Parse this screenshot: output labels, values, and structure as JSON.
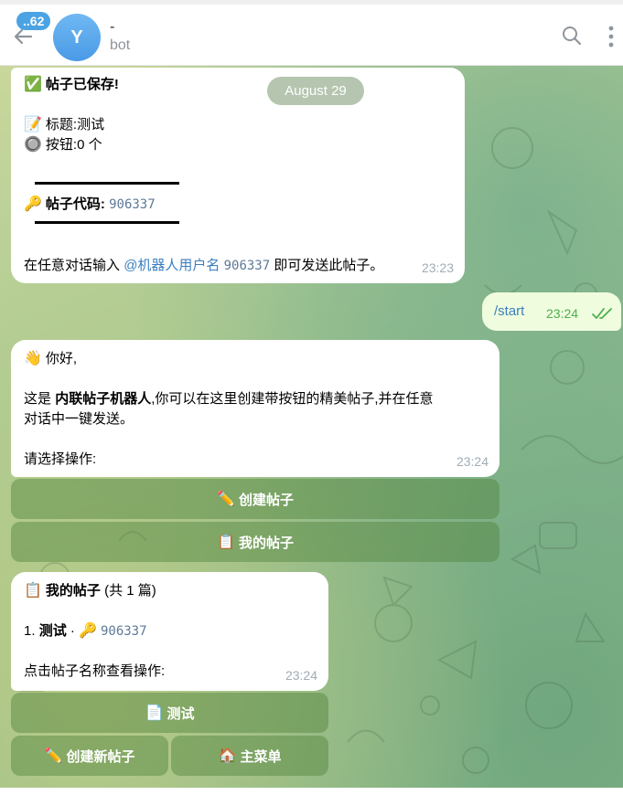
{
  "header": {
    "unread_count": "..62",
    "avatar_letter": "Y",
    "chat_name": "-",
    "chat_status": "bot"
  },
  "date_pill": "August 29",
  "msg_saved": {
    "title": "帖子已保存!",
    "title_label": "标题:",
    "title_value": "测试",
    "buttons_label": "按钮:",
    "buttons_value": "0 个",
    "code_label": "帖子代码:",
    "code_value": "906337",
    "hint_pre": "在任意对话输入",
    "hint_mention": "@机器人用户名",
    "hint_code": "906337",
    "hint_post": "即可发送此帖子。",
    "time": "23:23"
  },
  "msg_start": {
    "text": "/start",
    "time": "23:24"
  },
  "msg_welcome": {
    "greeting": "你好,",
    "line1_pre": "这是",
    "line1_bold": "内联帖子机器人",
    "line1_post": ",你可以在这里创建带按钮的精美帖子,并在任意",
    "line2": "对话中一键发送。",
    "prompt": "请选择操作:",
    "time": "23:24"
  },
  "kb_main": {
    "create_label": "创建帖子",
    "myposts_label": "我的帖子"
  },
  "msg_myposts": {
    "title": "我的帖子",
    "count": "(共 1 篇)",
    "item_index": "1.",
    "item_name": "测试",
    "item_sep": "·",
    "item_code": "906337",
    "hint": "点击帖子名称查看操作:",
    "time": "23:24"
  },
  "kb_posts": {
    "post_label": "测试",
    "create_new_label": "创建新帖子",
    "main_menu_label": "主菜单"
  },
  "colors": {
    "accent": "#4ba3e3",
    "link": "#3b7fc0",
    "code": "#5d7a97",
    "outgoing_bubble": "#effdde",
    "keyboard_button": "#6b9a58"
  }
}
